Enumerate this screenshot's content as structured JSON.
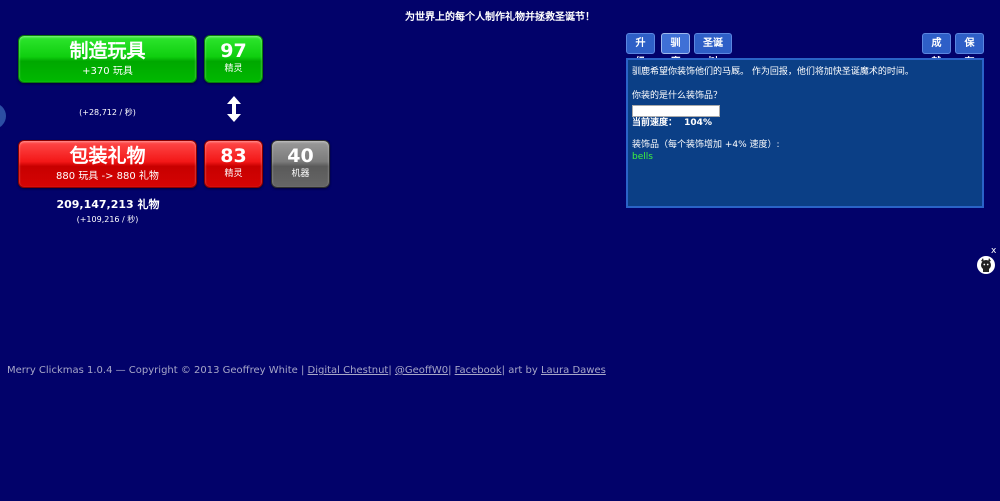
{
  "header": {
    "title": "为世界上的每个人制作礼物并拯救圣诞节！"
  },
  "toys": {
    "button_label": "制造玩具",
    "button_sub": "+370 玩具",
    "rate": "(+28,712 / 秒)",
    "elves_count": "97",
    "elves_label": "精灵"
  },
  "gifts": {
    "button_label": "包装礼物",
    "button_sub": "880 玩具 -> 880 礼物",
    "elves_count": "83",
    "elves_label": "精灵",
    "machines_count": "40",
    "machines_label": "机器",
    "total": "209,147,213 礼物",
    "rate": "(+109,216 / 秒)"
  },
  "tabs": {
    "upgrades": "升级",
    "reindeer": "驯鹿",
    "tree": "圣诞树",
    "achievements": "成就",
    "save": "保存"
  },
  "panel": {
    "intro": "驯鹿希望你装饰他们的马厩。 作为回报，他们将加快圣诞魔术的时间。",
    "question": "你装的是什么装饰品？",
    "input_value": "",
    "speed_label": "当前速度：",
    "speed_value": "104%",
    "decorations_label": "装饰品（每个装饰增加 +4% 速度）:",
    "decorations_list": "bells"
  },
  "footer": {
    "copyright": "Merry Clickmas 1.0.4 — Copyright © 2013 Geoffrey White |",
    "link_chestnut": "Digital Chestnut",
    "sep1": "|",
    "link_twitter": "@GeoffW0",
    "sep2": "|",
    "link_facebook": "Facebook",
    "art_by": "| art by",
    "link_artist": "Laura Dawes"
  },
  "widget": {
    "close": "x"
  },
  "colors": {
    "background": "#02026a",
    "green_button": "#0fcf0f",
    "red_button": "#f31717",
    "gray_button": "#7b7b7b",
    "tab_blue": "#2e5fc7",
    "panel_blue": "#0b3f86",
    "decoration_green": "#3ef23e"
  },
  "icons": {
    "arrow": "up-down-arrow-icon",
    "widget": "cat-icon",
    "close": "close-icon"
  }
}
